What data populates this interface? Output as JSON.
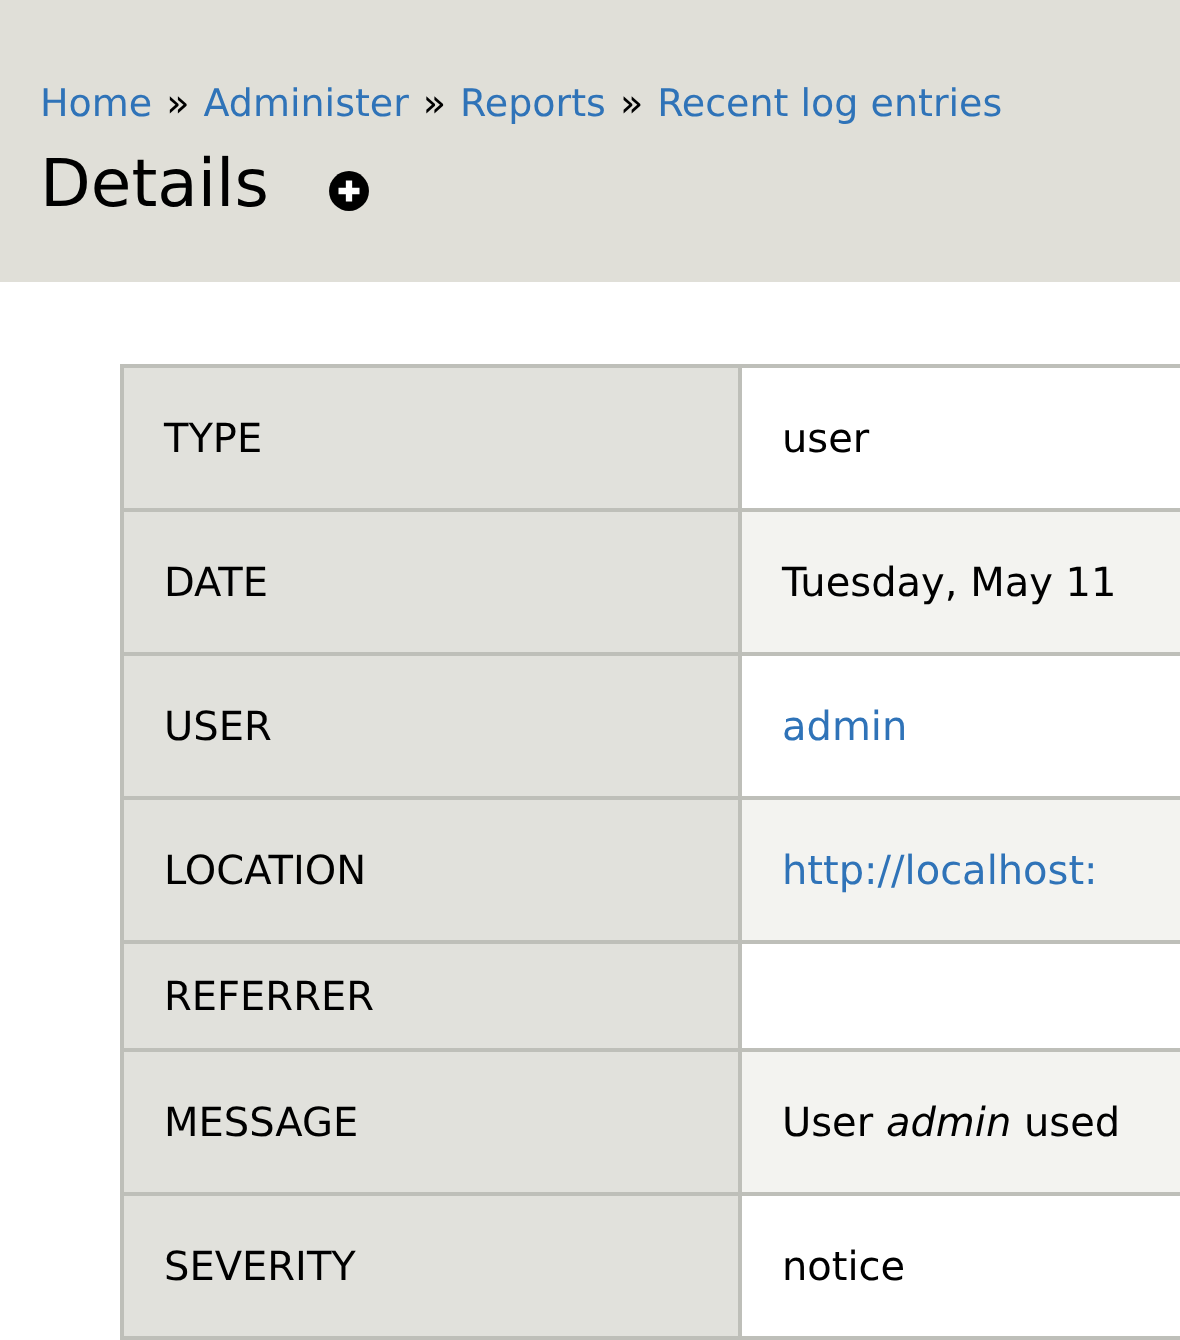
{
  "breadcrumb": [
    {
      "label": "Home"
    },
    {
      "label": "Administer"
    },
    {
      "label": "Reports"
    },
    {
      "label": "Recent log entries"
    }
  ],
  "breadcrumb_separator": "»",
  "title": "Details",
  "rows": [
    {
      "label": "TYPE",
      "value": "user",
      "kind": "text"
    },
    {
      "label": "DATE",
      "value": "Tuesday, May 11",
      "kind": "text"
    },
    {
      "label": "USER",
      "value": "admin",
      "kind": "link"
    },
    {
      "label": "LOCATION",
      "value": "http://localhost:",
      "kind": "link"
    },
    {
      "label": "REFERRER",
      "kind": "empty"
    },
    {
      "label": "MESSAGE",
      "value": "User *admin* used",
      "kind": "text"
    },
    {
      "label": "SEVERITY",
      "value": "notice",
      "kind": "text"
    }
  ]
}
